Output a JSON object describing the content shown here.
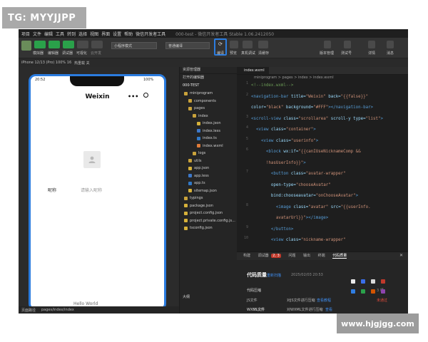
{
  "watermark_top": "TG: MYYJJPP",
  "watermark_bottom": "www.hjgjgg.com",
  "menubar": {
    "items": [
      "项目",
      "文件",
      "编辑",
      "工具",
      "转到",
      "选择",
      "视图",
      "界面",
      "设置",
      "帮助",
      "微信开发者工具"
    ],
    "title": "000-test - 微信开发者工具 Stable 1.06.2412050"
  },
  "toolbar": {
    "mode_select": "小程序模式",
    "compile_select": "普通编译",
    "labels": [
      "模拟器",
      "编辑器",
      "调试器",
      "可视化",
      "云开发",
      "编译",
      "预览",
      "真机调试",
      "清缓存",
      "版本管理",
      "测试号",
      "详情",
      "消息"
    ],
    "colors": {
      "green": "#2aa14a",
      "accent": "#2b7cdf"
    }
  },
  "statusrow": {
    "device": "iPhone 12/13 (Pro) 100% 16",
    "hotreload": "热重载 关"
  },
  "phone": {
    "time": "20:52",
    "battery": "100%",
    "title": "Weixin",
    "menu_icon": "more-dots-icon",
    "close_icon": "target-icon",
    "nickname_label": "昵称",
    "nickname_placeholder": "请输入昵称",
    "hello": "Hello World"
  },
  "sim_bottom": {
    "path_label": "页面路径",
    "path": "pages/index/index"
  },
  "explorer": {
    "header": "资源管理器",
    "open_editors": "打开的编辑器",
    "project": "000-TEST",
    "items": [
      {
        "label": "miniprogram",
        "kind": "folder"
      },
      {
        "label": "components",
        "kind": "folder"
      },
      {
        "label": "pages",
        "kind": "folder"
      },
      {
        "label": "index",
        "kind": "folder"
      },
      {
        "label": "index.json",
        "kind": "json"
      },
      {
        "label": "index.less",
        "kind": "less"
      },
      {
        "label": "index.ts",
        "kind": "ts"
      },
      {
        "label": "index.wxml",
        "kind": "wxml"
      },
      {
        "label": "logs",
        "kind": "folder"
      },
      {
        "label": "utils",
        "kind": "folder"
      },
      {
        "label": "app.json",
        "kind": "json"
      },
      {
        "label": "app.less",
        "kind": "less"
      },
      {
        "label": "app.ts",
        "kind": "ts"
      },
      {
        "label": "sitemap.json",
        "kind": "json"
      },
      {
        "label": "typings",
        "kind": "folder"
      },
      {
        "label": "package.json",
        "kind": "json"
      },
      {
        "label": "project.config.json",
        "kind": "json"
      },
      {
        "label": "project.private.config.js...",
        "kind": "json"
      },
      {
        "label": "tsconfig.json",
        "kind": "json"
      }
    ],
    "outline": "大纲"
  },
  "editor": {
    "tab": "index.wxml",
    "breadcrumb": "miniprogram > pages > index > index.wxml",
    "lines": [
      {
        "n": "1",
        "parts": [
          [
            "c",
            "<!--index.wxml-->"
          ]
        ]
      },
      {
        "n": "2",
        "parts": [
          [
            "t",
            "<navigation-bar "
          ],
          [
            "a",
            "title="
          ],
          [
            "s",
            "\"Weixin\" "
          ],
          [
            "a",
            "back="
          ],
          [
            "s",
            "\"{{false}}\""
          ]
        ]
      },
      {
        "n": "",
        "parts": [
          [
            "a",
            "color="
          ],
          [
            "s",
            "\"black\" "
          ],
          [
            "a",
            "background="
          ],
          [
            "s",
            "\"#FFF\""
          ],
          [
            "t",
            "></navigation-bar>"
          ]
        ]
      },
      {
        "n": "3",
        "parts": [
          [
            "t",
            "<scroll-view "
          ],
          [
            "a",
            "class="
          ],
          [
            "s",
            "\"scrollarea\" "
          ],
          [
            "a",
            "scroll-y "
          ],
          [
            "a",
            "type="
          ],
          [
            "s",
            "\"list\""
          ],
          [
            "t",
            ">"
          ]
        ]
      },
      {
        "n": "4",
        "parts": [
          [
            "p",
            "  "
          ],
          [
            "t",
            "<view "
          ],
          [
            "a",
            "class="
          ],
          [
            "s",
            "\"container\""
          ],
          [
            "t",
            ">"
          ]
        ]
      },
      {
        "n": "5",
        "parts": [
          [
            "p",
            "    "
          ],
          [
            "t",
            "<view "
          ],
          [
            "a",
            "class="
          ],
          [
            "s",
            "\"userinfo\""
          ],
          [
            "t",
            ">"
          ]
        ]
      },
      {
        "n": "6",
        "parts": [
          [
            "p",
            "      "
          ],
          [
            "t",
            "<block "
          ],
          [
            "a",
            "wx:if="
          ],
          [
            "s",
            "\"{{canIUseNicknameComp &&"
          ]
        ]
      },
      {
        "n": "",
        "parts": [
          [
            "s",
            "      !hasUserInfo}}\""
          ],
          [
            "t",
            ">"
          ]
        ]
      },
      {
        "n": "7",
        "parts": [
          [
            "p",
            "        "
          ],
          [
            "t",
            "<button "
          ],
          [
            "a",
            "class="
          ],
          [
            "s",
            "\"avatar-wrapper\""
          ]
        ]
      },
      {
        "n": "",
        "parts": [
          [
            "p",
            "        "
          ],
          [
            "a",
            "open-type="
          ],
          [
            "s",
            "\"chooseAvatar\""
          ]
        ]
      },
      {
        "n": "",
        "parts": [
          [
            "p",
            "        "
          ],
          [
            "a",
            "bind:chooseavatar="
          ],
          [
            "s",
            "\"onChooseAvatar\""
          ],
          [
            "t",
            ">"
          ]
        ]
      },
      {
        "n": "8",
        "parts": [
          [
            "p",
            "          "
          ],
          [
            "t",
            "<image "
          ],
          [
            "a",
            "class="
          ],
          [
            "s",
            "\"avatar\" "
          ],
          [
            "a",
            "src="
          ],
          [
            "s",
            "\"{{userInfo."
          ]
        ]
      },
      {
        "n": "",
        "parts": [
          [
            "s",
            "          avatarUrl}}\""
          ],
          [
            "t",
            "></image>"
          ]
        ]
      },
      {
        "n": "9",
        "parts": [
          [
            "p",
            "        "
          ],
          [
            "t",
            "</button>"
          ]
        ]
      },
      {
        "n": "10",
        "parts": [
          [
            "p",
            "        "
          ],
          [
            "t",
            "<view "
          ],
          [
            "a",
            "class="
          ],
          [
            "s",
            "\"nickname-wrapper\""
          ]
        ]
      }
    ]
  },
  "panel": {
    "tabs": [
      "构建",
      "调试器",
      "问题",
      "输出",
      "终端",
      "代码质量"
    ],
    "badge": "2, 3",
    "title": "代码质量",
    "refresh": "重新扫描",
    "time": "2025/02/03 20:53",
    "section": "代码压缩",
    "rows": [
      {
        "name": "JS文件",
        "desc": "对JS文件进行压缩",
        "link": "查看教程",
        "status": "未通过"
      },
      {
        "name": "WXML文件",
        "desc": "对WXML文件进行压缩",
        "link": "查看",
        "status": ""
      },
      {
        "name": "WXSS文件",
        "desc": "对WXSS文件进行压缩",
        "link": "查看",
        "status": ""
      }
    ],
    "group_count": "3 项"
  }
}
